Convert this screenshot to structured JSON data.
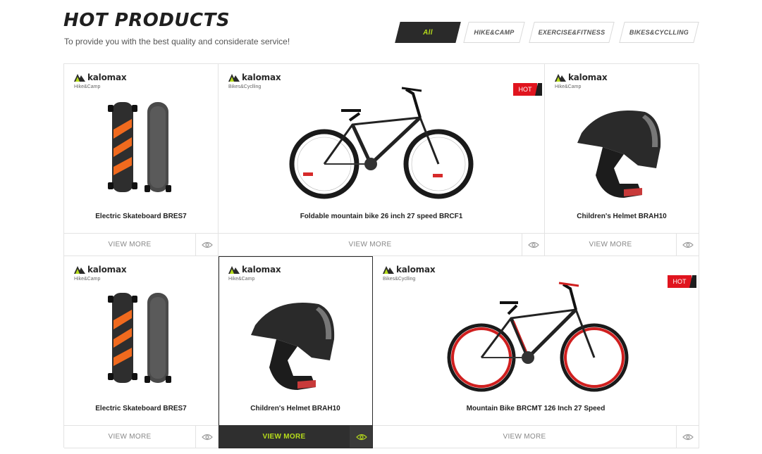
{
  "header": {
    "title": "HOT PRODUCTS",
    "subtitle": "To provide you with the best quality and considerate service!"
  },
  "filters": [
    {
      "label": "All",
      "active": true
    },
    {
      "label": "HIKE&CAMP",
      "active": false
    },
    {
      "label": "EXERCISE&FITNESS",
      "active": false
    },
    {
      "label": "BIKES&CYCLLING",
      "active": false
    }
  ],
  "products": [
    {
      "brand": "kalomax",
      "category": "Hike&Camp",
      "name": "Electric Skateboard BRES7",
      "action": "VIEW MORE",
      "hot": false,
      "image": "skateboard-image"
    },
    {
      "brand": "kalomax",
      "category": "Bikes&Cyclling",
      "name": "Foldable mountain bike 26 inch 27 speed BRCF1",
      "action": "VIEW MORE",
      "hot": true,
      "hot_label": "HOT",
      "image": "mountain-bike-black-image"
    },
    {
      "brand": "kalomax",
      "category": "Hike&Camp",
      "name": "Children's Helmet BRAH10",
      "action": "VIEW MORE",
      "hot": false,
      "image": "helmet-image"
    },
    {
      "brand": "kalomax",
      "category": "Hike&Camp",
      "name": "Electric Skateboard BRES7",
      "action": "VIEW MORE",
      "hot": false,
      "image": "skateboard-image"
    },
    {
      "brand": "kalomax",
      "category": "Hike&Camp",
      "name": "Children's Helmet BRAH10",
      "action": "VIEW MORE",
      "hot": false,
      "highlighted": true,
      "image": "helmet-image"
    },
    {
      "brand": "kalomax",
      "category": "Bikes&Cyclling",
      "name": "Mountain Bike BRCMT 126 Inch 27 Speed",
      "action": "VIEW MORE",
      "hot": true,
      "hot_label": "HOT",
      "image": "mountain-bike-red-image"
    }
  ],
  "colors": {
    "accent_green": "#b6dc1b",
    "hot_red": "#e0141e",
    "dark": "#2a2a2a"
  }
}
